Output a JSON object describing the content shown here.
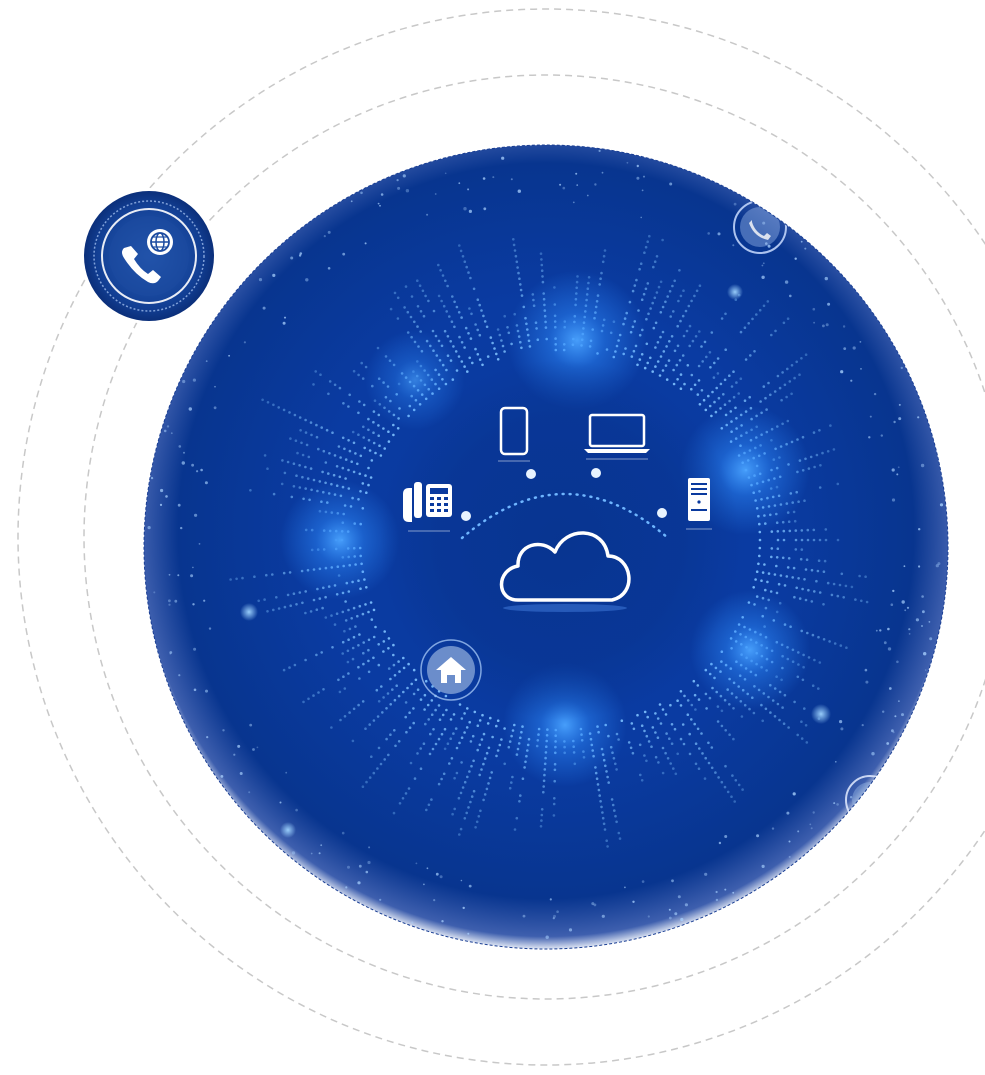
{
  "theme": {
    "background": "#ffffff",
    "orbit_color": "#c8c8c8",
    "globe_core": "#0a3a9e",
    "globe_mid": "#08379a",
    "globe_edge": "#07307f",
    "globe_rim": "#cfd9ef",
    "glow": "#2f8dff",
    "dot": "#7fc3ff",
    "icon_white": "#ffffff",
    "badge_fill": "#0b3a8f"
  },
  "icons": {
    "center": "cloud-icon",
    "devices": [
      "desk-phone-icon",
      "mobile-phone-icon",
      "laptop-icon",
      "server-icon"
    ],
    "orbit_badges": [
      "globe-phone-icon",
      "phone-icon",
      "home-icon",
      "phone-icon"
    ]
  }
}
